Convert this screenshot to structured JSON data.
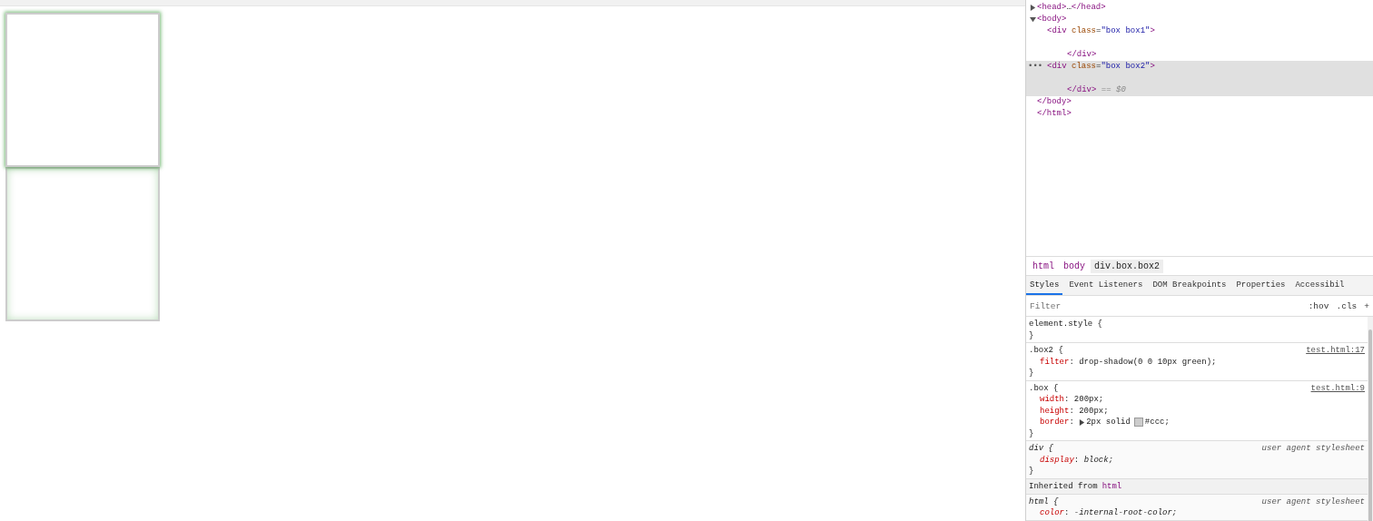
{
  "viewport": {
    "boxes": [
      {
        "kind": "outer-glow"
      },
      {
        "kind": "inner-glow"
      }
    ]
  },
  "devtools": {
    "dom_tree": {
      "nodes": [
        {
          "expanded": false,
          "selected": false,
          "open": [
            {
              "kind": "tag",
              "text": "<head>"
            },
            {
              "kind": "text",
              "text": "…"
            },
            {
              "kind": "tag",
              "text": "</head>"
            }
          ]
        },
        {
          "expanded": true,
          "selected": false,
          "open": [
            {
              "kind": "tag",
              "text": "<body>"
            }
          ],
          "children": [
            {
              "selected": false,
              "open": [
                {
                  "kind": "tag",
                  "text": "<div"
                },
                {
                  "kind": "attr",
                  "text": " class"
                },
                {
                  "kind": "text",
                  "text": "="
                },
                {
                  "kind": "value",
                  "text": "\"box box1\""
                },
                {
                  "kind": "tag",
                  "text": ">"
                }
              ],
              "close": [
                {
                  "kind": "tag",
                  "text": "</div>"
                }
              ]
            },
            {
              "selected": true,
              "gutter_mark": "•••",
              "open": [
                {
                  "kind": "tag",
                  "text": "<div"
                },
                {
                  "kind": "attr",
                  "text": " class"
                },
                {
                  "kind": "text",
                  "text": "="
                },
                {
                  "kind": "value",
                  "text": "\"box box2\""
                },
                {
                  "kind": "tag",
                  "text": ">"
                }
              ],
              "close": [
                {
                  "kind": "tag",
                  "text": "</div>"
                },
                {
                  "kind": "note",
                  "text": " == $0"
                }
              ]
            }
          ],
          "close": [
            {
              "kind": "tag",
              "text": "</body>"
            }
          ]
        }
      ],
      "close": [
        {
          "kind": "tag",
          "text": "</html>"
        }
      ]
    },
    "breadcrumbs": [
      {
        "label": "html",
        "selected": false
      },
      {
        "label": "body",
        "selected": false
      },
      {
        "label": "div.box.box2",
        "selected": true
      }
    ],
    "tabs": [
      {
        "label": "Styles",
        "selected": true
      },
      {
        "label": "Event Listeners",
        "selected": false
      },
      {
        "label": "DOM Breakpoints",
        "selected": false
      },
      {
        "label": "Properties",
        "selected": false
      },
      {
        "label": "Accessibil",
        "selected": false
      }
    ],
    "filter": {
      "placeholder": "Filter",
      "buttons": [
        ":hov",
        ".cls",
        "+"
      ]
    },
    "rules": [
      {
        "kind": "author",
        "selector": "element.style {",
        "close": "}"
      },
      {
        "kind": "author",
        "selector": ".box2 {",
        "source": "test.html:17",
        "close": "}",
        "declarations": [
          {
            "property": "filter",
            "separator": ":",
            "value": "drop-shadow(0 0 10px green);"
          }
        ]
      },
      {
        "kind": "author",
        "selector": ".box {",
        "source": "test.html:9",
        "close": "}",
        "declarations": [
          {
            "property": "width",
            "separator": ":",
            "value": "200px;"
          },
          {
            "property": "height",
            "separator": ":",
            "value": "200px;"
          },
          {
            "property": "border",
            "separator": ":",
            "value": "2px solid",
            "expandable": true,
            "color": "#cccccc",
            "color_text": "#ccc;"
          }
        ]
      },
      {
        "kind": "user-agent",
        "selector": "div {",
        "source": "user agent stylesheet",
        "close": "}",
        "declarations": [
          {
            "property": "display",
            "separator": ":",
            "value": "block;"
          }
        ]
      },
      {
        "kind": "inherited",
        "label": "Inherited from",
        "link": "html"
      },
      {
        "kind": "user-agent",
        "selector": "html {",
        "source": "user agent stylesheet",
        "declarations": [
          {
            "property": "color",
            "separator": ":",
            "value": "-internal-root-color;"
          }
        ]
      }
    ]
  }
}
